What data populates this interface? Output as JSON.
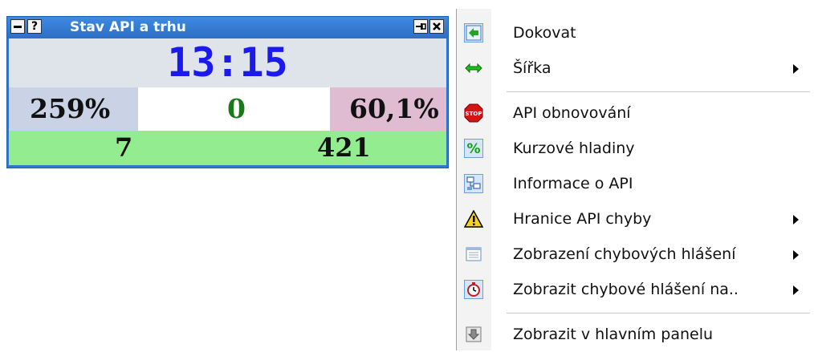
{
  "widget": {
    "title": "Stav API a trhu",
    "time": "13:15",
    "left_value": "259%",
    "center_value": "0",
    "right_value": "60,1%",
    "bottom_left": "7",
    "bottom_right": "421",
    "colors": {
      "title_bar": "#2f77cf",
      "time_text": "#1a1aee",
      "center_text": "#1a7a1a",
      "left_cell_bg": "#c9d3e5",
      "right_cell_bg": "#dfbcd1",
      "bottom_bg": "#93ec8f"
    }
  },
  "menu": {
    "items": [
      {
        "label": "Dokovat",
        "icon": "dock-icon",
        "submenu": false
      },
      {
        "label": "Šířka",
        "icon": "width-arrows-icon",
        "submenu": true
      },
      {
        "label": "API obnovování",
        "icon": "stop-sign-icon",
        "submenu": false
      },
      {
        "label": "Kurzové hladiny",
        "icon": "percent-icon",
        "submenu": false
      },
      {
        "label": "Informace o API",
        "icon": "network-info-icon",
        "submenu": false
      },
      {
        "label": "Hranice API chyby",
        "icon": "warning-icon",
        "submenu": true
      },
      {
        "label": "Zobrazení chybových hlášení",
        "icon": "table-icon",
        "submenu": true
      },
      {
        "label": "Zobrazit chybové hlášení na..",
        "icon": "stopwatch-icon",
        "submenu": true
      },
      {
        "label": "Zobrazit v hlavním panelu",
        "icon": "down-arrow-icon",
        "submenu": false
      }
    ]
  }
}
